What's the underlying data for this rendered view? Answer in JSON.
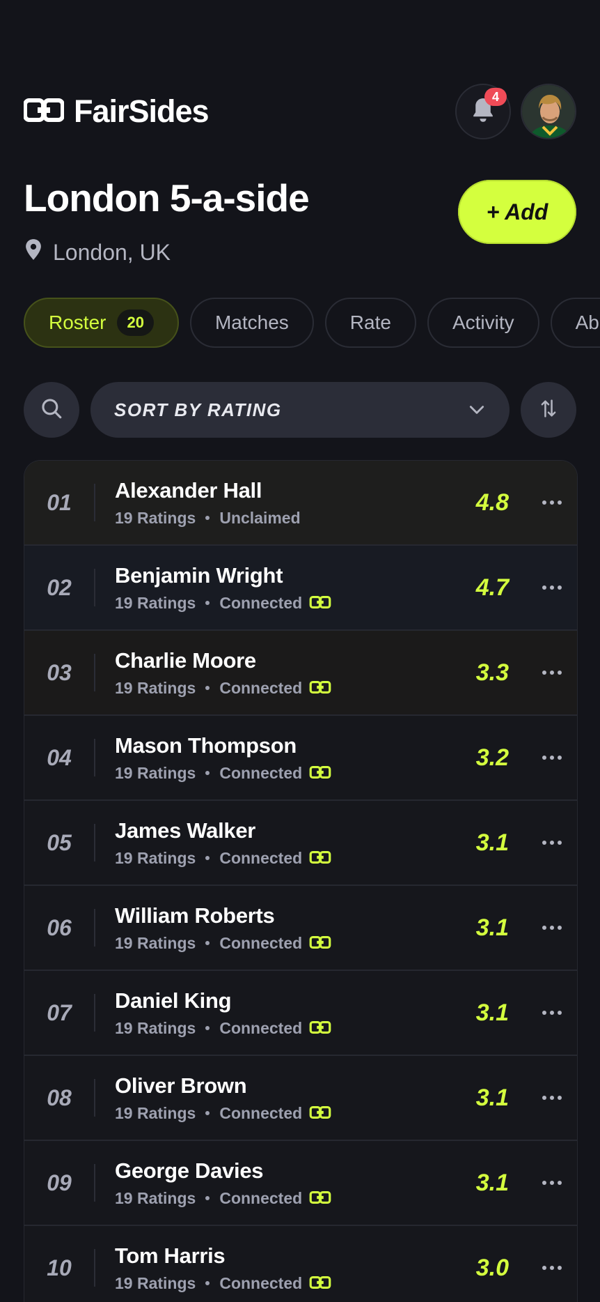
{
  "app": {
    "brand_name": "FairSides"
  },
  "header": {
    "notifications_count": "4"
  },
  "group": {
    "title": "London 5-a-side",
    "location": "London, UK",
    "add_label": "+ Add"
  },
  "tabs": [
    {
      "label": "Roster",
      "count": "20",
      "active": true
    },
    {
      "label": "Matches"
    },
    {
      "label": "Rate"
    },
    {
      "label": "Activity"
    },
    {
      "label": "Abo"
    }
  ],
  "toolbar": {
    "sort_label": "SORT BY RATING"
  },
  "roster": [
    {
      "rank": "01",
      "name": "Alexander Hall",
      "ratings": "19 Ratings",
      "status": "Unclaimed",
      "score": "4.8"
    },
    {
      "rank": "02",
      "name": "Benjamin Wright",
      "ratings": "19 Ratings",
      "status": "Connected",
      "score": "4.7"
    },
    {
      "rank": "03",
      "name": "Charlie Moore",
      "ratings": "19 Ratings",
      "status": "Connected",
      "score": "3.3"
    },
    {
      "rank": "04",
      "name": "Mason Thompson",
      "ratings": "19 Ratings",
      "status": "Connected",
      "score": "3.2"
    },
    {
      "rank": "05",
      "name": "James Walker",
      "ratings": "19 Ratings",
      "status": "Connected",
      "score": "3.1"
    },
    {
      "rank": "06",
      "name": "William Roberts",
      "ratings": "19 Ratings",
      "status": "Connected",
      "score": "3.1"
    },
    {
      "rank": "07",
      "name": "Daniel King",
      "ratings": "19 Ratings",
      "status": "Connected",
      "score": "3.1"
    },
    {
      "rank": "08",
      "name": "Oliver Brown",
      "ratings": "19 Ratings",
      "status": "Connected",
      "score": "3.1"
    },
    {
      "rank": "09",
      "name": "George Davies",
      "ratings": "19 Ratings",
      "status": "Connected",
      "score": "3.1"
    },
    {
      "rank": "10",
      "name": "Tom Harris",
      "ratings": "19 Ratings",
      "status": "Connected",
      "score": "3.0"
    }
  ],
  "icons": {
    "logo": "fairsides-logo-icon",
    "bell": "bell-icon",
    "location": "location-pin-icon",
    "search": "search-icon",
    "chevron": "chevron-down-icon",
    "sort": "sort-direction-icon",
    "connected": "fairsides-connected-icon",
    "more": "more-horizontal-icon"
  },
  "colors": {
    "accent": "#d4ff3e",
    "background": "#13141a",
    "badge": "#ef4b57"
  }
}
